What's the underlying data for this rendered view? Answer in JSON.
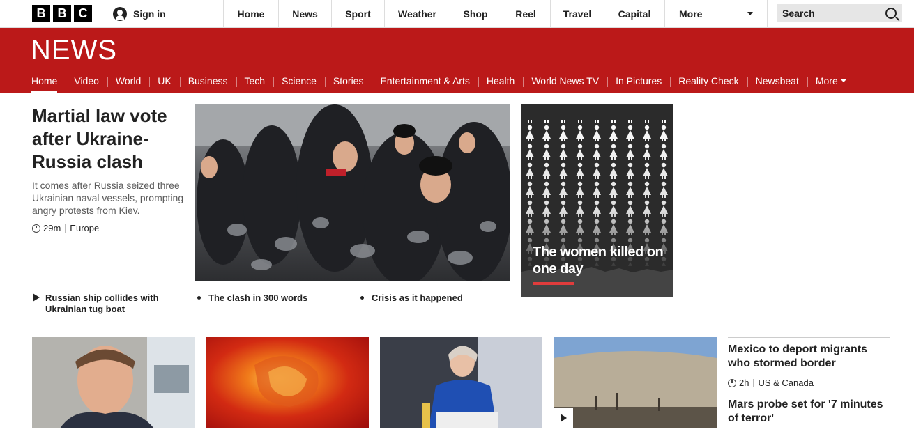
{
  "brand": {
    "logo_letters": [
      "B",
      "B",
      "C"
    ]
  },
  "topbar": {
    "signin_label": "Sign in",
    "nav": [
      "Home",
      "News",
      "Sport",
      "Weather",
      "Shop",
      "Reel",
      "Travel",
      "Capital",
      "More"
    ],
    "search_placeholder": "Search"
  },
  "news_band": {
    "title": "NEWS",
    "sections": [
      "Home",
      "Video",
      "World",
      "UK",
      "Business",
      "Tech",
      "Science",
      "Stories",
      "Entertainment & Arts",
      "Health",
      "World News TV",
      "In Pictures",
      "Reality Check",
      "Newsbeat",
      "More"
    ],
    "active_section": "Home"
  },
  "lead_story": {
    "headline": "Martial law vote after Ukraine-Russia clash",
    "summary": "It comes after Russia seized three Ukrainian naval vessels, prompting angry protests from Kiev.",
    "time": "29m",
    "category": "Europe",
    "related": [
      {
        "label": "Russian ship collides with Ukrainian tug boat",
        "kind": "video"
      },
      {
        "label": "The clash in 300 words",
        "kind": "article"
      },
      {
        "label": "Crisis as it happened",
        "kind": "article"
      }
    ]
  },
  "promo": {
    "title": "The women killed on one day",
    "accent_color": "#e03c3c"
  },
  "secondary_stories": [
    {
      "headline": "Mexico to deport migrants who stormed border",
      "time": "2h",
      "category": "US & Canada"
    },
    {
      "headline": "Mars probe set for '7 minutes of terror'"
    }
  ],
  "colors": {
    "brand_red": "#bb1919",
    "text": "#222222",
    "summary_text": "#5a5a5a"
  }
}
